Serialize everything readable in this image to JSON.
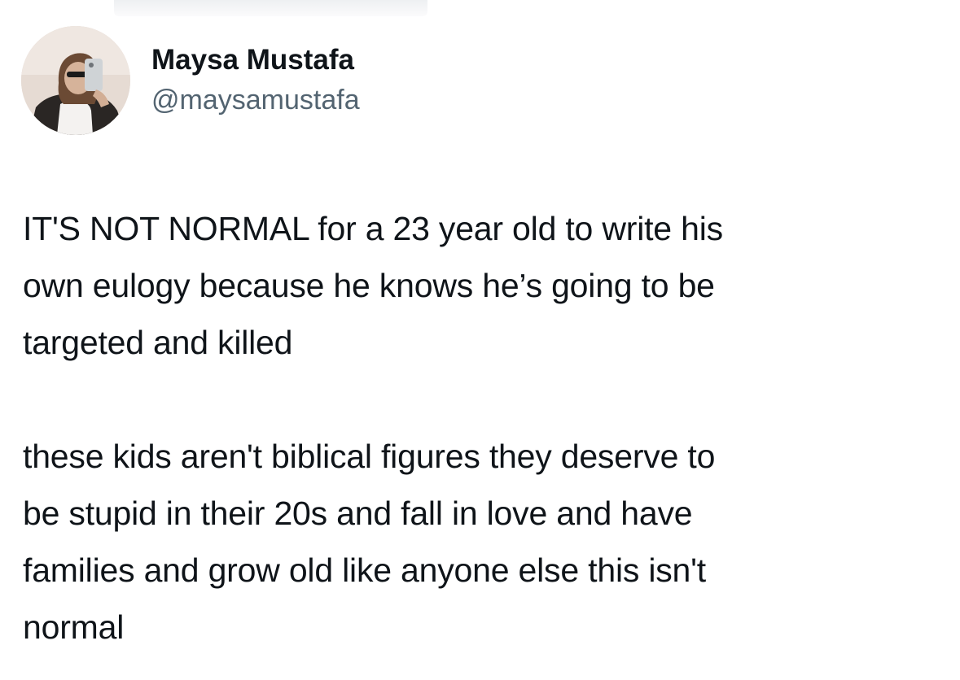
{
  "tweet": {
    "author": {
      "display_name": "Maysa Mustafa",
      "handle": "@maysamustafa",
      "avatar_icon": "profile-photo-avatar"
    },
    "paragraphs": [
      "IT'S NOT NORMAL for a 23 year old to write his\nown eulogy because he knows he’s going to be\ntargeted and killed",
      "these kids aren't biblical figures they deserve to\nbe stupid in their 20s and fall in love and have\nfamilies and grow old like anyone else this isn't\nnormal"
    ]
  },
  "colors": {
    "text_primary": "#0f1419",
    "text_secondary": "#536471",
    "background": "#ffffff"
  }
}
